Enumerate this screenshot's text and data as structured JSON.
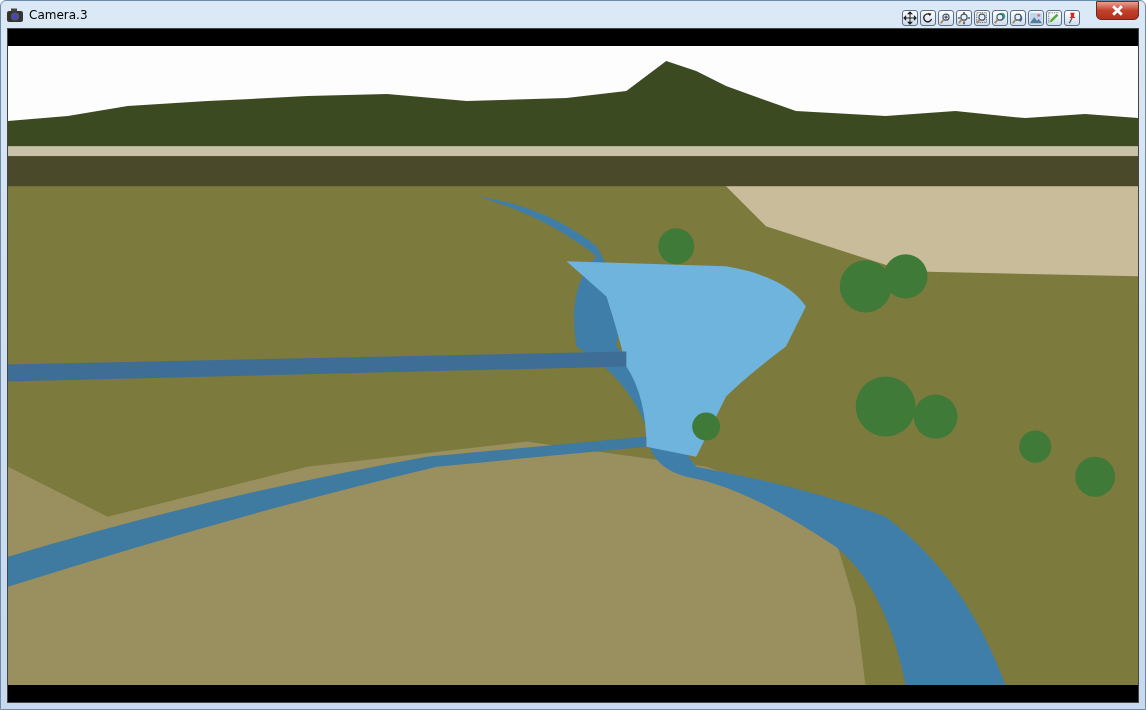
{
  "window": {
    "title": "Camera.3"
  }
}
